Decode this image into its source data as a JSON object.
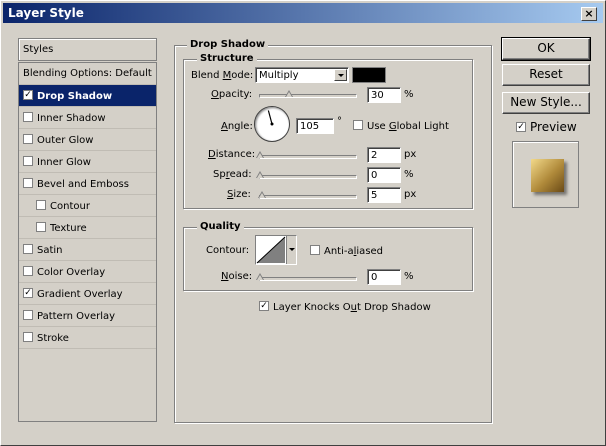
{
  "window": {
    "title": "Layer Style",
    "close_symbol": "×"
  },
  "sidebar": {
    "header": "Styles",
    "items": [
      {
        "label": "Blending Options: Default",
        "checkbox": false,
        "checked": false,
        "selected": false,
        "indent": false
      },
      {
        "label": "Drop Shadow",
        "checkbox": true,
        "checked": true,
        "selected": true,
        "indent": false
      },
      {
        "label": "Inner Shadow",
        "checkbox": true,
        "checked": false,
        "selected": false,
        "indent": false
      },
      {
        "label": "Outer Glow",
        "checkbox": true,
        "checked": false,
        "selected": false,
        "indent": false
      },
      {
        "label": "Inner Glow",
        "checkbox": true,
        "checked": false,
        "selected": false,
        "indent": false
      },
      {
        "label": "Bevel and Emboss",
        "checkbox": true,
        "checked": false,
        "selected": false,
        "indent": false
      },
      {
        "label": "Contour",
        "checkbox": true,
        "checked": false,
        "selected": false,
        "indent": true
      },
      {
        "label": "Texture",
        "checkbox": true,
        "checked": false,
        "selected": false,
        "indent": true
      },
      {
        "label": "Satin",
        "checkbox": true,
        "checked": false,
        "selected": false,
        "indent": false
      },
      {
        "label": "Color Overlay",
        "checkbox": true,
        "checked": false,
        "selected": false,
        "indent": false
      },
      {
        "label": "Gradient Overlay",
        "checkbox": true,
        "checked": true,
        "selected": false,
        "indent": false
      },
      {
        "label": "Pattern Overlay",
        "checkbox": true,
        "checked": false,
        "selected": false,
        "indent": false
      },
      {
        "label": "Stroke",
        "checkbox": true,
        "checked": false,
        "selected": false,
        "indent": false
      }
    ]
  },
  "drop_shadow": {
    "title": "Drop Shadow",
    "structure": {
      "title": "Structure",
      "blend_mode_label": "Blend Mode:",
      "blend_mode_value": "Multiply",
      "shadow_color": "#000000",
      "opacity_label": "Opacity:",
      "opacity_value": "30",
      "opacity_unit": "%",
      "opacity_fraction": 0.3,
      "angle_label": "Angle:",
      "angle_value": "105",
      "angle_unit": "°",
      "global_light_label": "Use Global Light",
      "global_light_checked": false,
      "distance_label": "Distance:",
      "distance_value": "2",
      "distance_unit": "px",
      "spread_label": "Spread:",
      "spread_value": "0",
      "spread_unit": "%",
      "size_label": "Size:",
      "size_value": "5",
      "size_unit": "px"
    },
    "quality": {
      "title": "Quality",
      "contour_label": "Contour:",
      "anti_aliased_label": "Anti-aliased",
      "anti_aliased_checked": false,
      "noise_label": "Noise:",
      "noise_value": "0",
      "noise_unit": "%"
    },
    "knockout_label": "Layer Knocks Out Drop Shadow",
    "knockout_checked": true
  },
  "buttons": {
    "ok": "OK",
    "reset": "Reset",
    "new_style": "New Style..."
  },
  "preview": {
    "label": "Preview",
    "checked": true
  }
}
